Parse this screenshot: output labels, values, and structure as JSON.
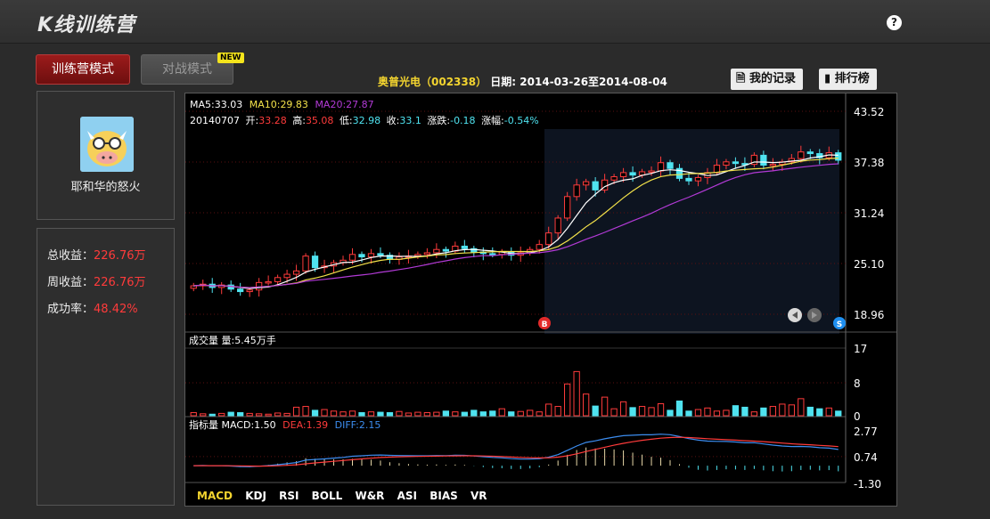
{
  "app": {
    "title": "K线训练营",
    "help_icon": "?"
  },
  "modes": {
    "train": "训练营模式",
    "battle": "对战模式",
    "new_badge": "NEW"
  },
  "user": {
    "name": "耶和华的怒火"
  },
  "stats": [
    {
      "label": "总收益：",
      "value": "226.76万"
    },
    {
      "label": "周收益：",
      "value": "226.76万"
    },
    {
      "label": "成功率：",
      "value": "48.42%"
    }
  ],
  "stock": {
    "name": "奥普光电（002338）",
    "date_label": "日期:",
    "date_range": "2014-03-26至2014-08-04"
  },
  "toolbar": {
    "records": "我的记录",
    "ranking": "排行榜"
  },
  "colors": {
    "up": "#ff3b3b",
    "down": "#4fe3f0",
    "ma5": "#ffffff",
    "ma10": "#f3e24a",
    "ma20": "#b23ad6",
    "brand_red": "#8f1717"
  },
  "ma_line": {
    "ma5": "MA5:33.03",
    "ma10": "MA10:29.83",
    "ma20": "MA20:27.87"
  },
  "ohlc_line": {
    "date": "20140707",
    "open_l": "开:",
    "open": "33.28",
    "high_l": "高:",
    "high": "35.08",
    "low_l": "低:",
    "low": "32.98",
    "close_l": "收:",
    "close": "33.1",
    "chg_l": "涨跌:",
    "chg": "-0.18",
    "pct_l": "涨幅:",
    "pct": "-0.54%"
  },
  "price_axis": [
    "43.52",
    "37.38",
    "31.24",
    "25.10",
    "18.96"
  ],
  "volume": {
    "label": "成交量 量:5.45万手",
    "axis": [
      "17",
      "8",
      "0"
    ]
  },
  "macd": {
    "label": "指标量 MACD:1.50",
    "dea": "DEA:1.39",
    "diff": "DIFF:2.15",
    "axis": [
      "2.77",
      "0.74",
      "-1.30"
    ]
  },
  "markers": {
    "buy": "B",
    "sell": "S"
  },
  "indicator_tabs": [
    "MACD",
    "KDJ",
    "RSI",
    "BOLL",
    "W&R",
    "ASI",
    "BIAS",
    "VR"
  ],
  "active_tab": "MACD",
  "chart_data": {
    "type": "candlestick",
    "closes": [
      22.4,
      22.6,
      22.2,
      22.5,
      22.0,
      21.7,
      21.9,
      22.8,
      22.9,
      23.4,
      23.8,
      24.2,
      26.0,
      24.6,
      24.8,
      25.2,
      25.5,
      26.2,
      25.9,
      26.3,
      26.1,
      25.6,
      25.9,
      26.0,
      26.2,
      26.4,
      26.8,
      26.6,
      27.2,
      26.9,
      26.5,
      26.3,
      26.2,
      26.5,
      26.1,
      26.4,
      26.8,
      27.4,
      28.8,
      30.6,
      33.2,
      34.6,
      35.0,
      34.0,
      35.2,
      35.6,
      36.1,
      35.8,
      36.2,
      36.3,
      37.3,
      36.6,
      35.4,
      35.1,
      35.5,
      36.1,
      37.0,
      37.4,
      37.2,
      37.1,
      38.2,
      37.0,
      37.1,
      37.4,
      37.8,
      38.6,
      38.4,
      37.9,
      38.5,
      37.6
    ],
    "opens": [
      22.1,
      22.4,
      22.6,
      22.2,
      22.5,
      22.0,
      21.7,
      21.9,
      22.8,
      22.9,
      23.4,
      23.8,
      24.2,
      26.0,
      24.6,
      24.8,
      25.2,
      25.5,
      26.2,
      25.9,
      26.3,
      26.1,
      25.6,
      25.9,
      26.0,
      26.2,
      26.4,
      26.8,
      26.6,
      27.2,
      26.9,
      26.5,
      26.3,
      26.2,
      26.5,
      26.1,
      26.4,
      26.8,
      27.4,
      28.8,
      30.6,
      33.2,
      34.6,
      35.0,
      34.0,
      35.2,
      35.6,
      36.1,
      35.8,
      36.2,
      36.3,
      37.3,
      36.6,
      35.4,
      35.1,
      35.5,
      36.1,
      37.0,
      37.4,
      37.2,
      37.1,
      38.2,
      37.0,
      37.1,
      37.4,
      37.8,
      38.6,
      38.4,
      37.9,
      38.5
    ],
    "volumes": [
      0.8,
      0.5,
      0.4,
      0.6,
      0.9,
      0.8,
      0.6,
      0.5,
      0.4,
      0.7,
      0.6,
      2.2,
      2.4,
      1.4,
      1.6,
      1.2,
      1.0,
      1.2,
      0.8,
      1.0,
      0.9,
      0.8,
      1.1,
      0.7,
      0.9,
      0.8,
      0.9,
      1.2,
      1.0,
      0.9,
      1.4,
      1.0,
      1.2,
      1.8,
      1.0,
      1.1,
      1.4,
      1.0,
      3.0,
      2.4,
      8.2,
      11.4,
      5.6,
      2.5,
      4.8,
      1.8,
      3.6,
      2.1,
      2.4,
      2.1,
      3.1,
      1.4,
      3.8,
      1.2,
      1.6,
      2.0,
      1.2,
      1.4,
      2.6,
      2.2,
      1.0,
      2.0,
      2.4,
      3.0,
      2.8,
      4.4,
      2.2,
      1.8,
      2.0,
      1.2
    ],
    "ma_series": [
      "MA5",
      "MA10",
      "MA20"
    ],
    "ylim": [
      18.96,
      43.52
    ],
    "volume_ylim": [
      0,
      17
    ],
    "macd_ylim": [
      -1.3,
      2.77
    ]
  }
}
